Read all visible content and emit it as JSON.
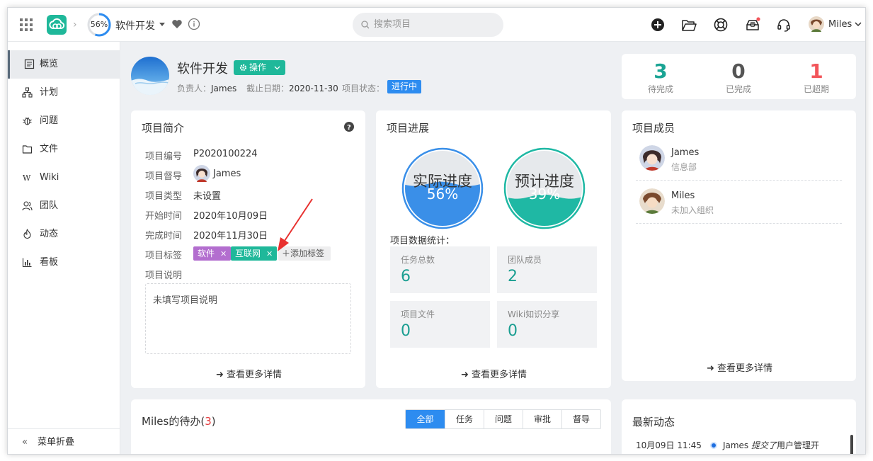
{
  "topbar": {
    "progress_label": "56%",
    "progress": 0.56,
    "project_name": "软件开发",
    "search_placeholder": "搜索项目",
    "user_name": "Miles"
  },
  "sidebar": {
    "items": [
      {
        "label": "概览",
        "icon": "overview-icon",
        "active": true
      },
      {
        "label": "计划",
        "icon": "plan-icon"
      },
      {
        "label": "问题",
        "icon": "bug-icon"
      },
      {
        "label": "文件",
        "icon": "folder-icon"
      },
      {
        "label": "Wiki",
        "icon": "wiki-icon"
      },
      {
        "label": "团队",
        "icon": "team-icon"
      },
      {
        "label": "动态",
        "icon": "activity-icon"
      },
      {
        "label": "看板",
        "icon": "board-icon"
      }
    ],
    "collapse_label": "菜单折叠"
  },
  "header": {
    "title": "软件开发",
    "op_button": "操作",
    "owner_label": "负责人：",
    "owner": "James",
    "deadline_label": "截止日期：",
    "deadline": "2020-11-30",
    "status_label": "项目状态：",
    "status": "进行中"
  },
  "stats": [
    {
      "value": "3",
      "label": "待完成",
      "color": "#1aa494"
    },
    {
      "value": "0",
      "label": "已完成",
      "color": "#555555"
    },
    {
      "value": "1",
      "label": "已超期",
      "color": "#f2555a"
    }
  ],
  "intro": {
    "title": "项目简介",
    "fields": [
      {
        "key": "项目编号",
        "value": "P2020100224"
      },
      {
        "key": "项目督导",
        "value": "James"
      },
      {
        "key": "项目类型",
        "value": "未设置"
      },
      {
        "key": "开始时间",
        "value": "2020年10月09日"
      },
      {
        "key": "完成时间",
        "value": "2020年11月30日"
      },
      {
        "key": "项目标签",
        "value": ""
      },
      {
        "key": "项目说明",
        "value": ""
      }
    ],
    "tags": [
      {
        "label": "软件",
        "color": "#b36ecf"
      },
      {
        "label": "互联网",
        "color": "#1fb89a"
      }
    ],
    "add_tag": "添加标签",
    "description": "未填写项目说明",
    "more": "查看更多详情"
  },
  "progress": {
    "title": "项目进展",
    "actual_label": "实际进度",
    "actual_value": "56%",
    "actual_fraction": 0.56,
    "planned_label": "预计进度",
    "planned_value": "39%",
    "planned_fraction": 0.39,
    "stats_title": "项目数据统计：",
    "boxes": [
      {
        "label": "任务总数",
        "value": "6"
      },
      {
        "label": "团队成员",
        "value": "2"
      },
      {
        "label": "项目文件",
        "value": "0"
      },
      {
        "label": "Wiki知识分享",
        "value": "0"
      }
    ],
    "more": "查看更多详情"
  },
  "members": {
    "title": "项目成员",
    "list": [
      {
        "name": "James",
        "dept": "信息部"
      },
      {
        "name": "Miles",
        "dept": "未加入组织"
      }
    ],
    "more": "查看更多详情"
  },
  "todo": {
    "title": "Miles的待办",
    "count": "3",
    "tabs": [
      "全部",
      "任务",
      "问题",
      "审批",
      "督导"
    ]
  },
  "activity": {
    "title": "最新动态",
    "items": [
      {
        "time": "10月09日 11:45",
        "user": "James",
        "action": "提交了",
        "text": "用户管理开"
      }
    ]
  }
}
